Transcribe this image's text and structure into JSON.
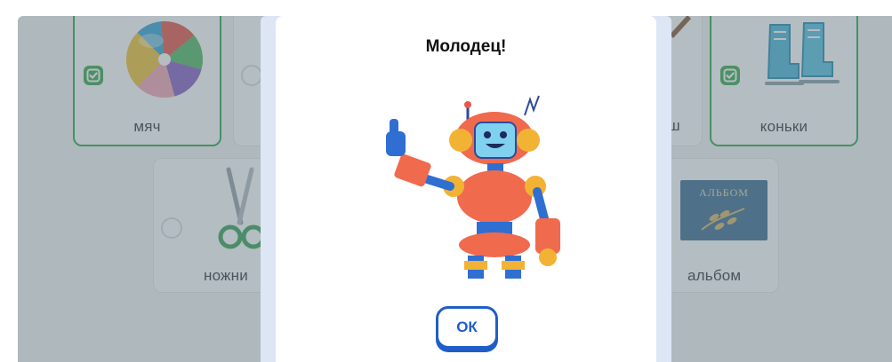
{
  "cards": {
    "ball_label": "мяч",
    "pencil_label_partial": "ш",
    "skates_label": "коньки",
    "scissors_label_partial": "ножни",
    "album_label": "альбом",
    "album_cover_text": "АЛЬБОМ"
  },
  "modal": {
    "title": "Молодец!",
    "ok_label": "ОК",
    "illustration": "robot-thumbs-up-icon"
  },
  "colors": {
    "selected_border": "#35a853",
    "check_fill": "#3cab52",
    "ok_accent": "#1f5ec8",
    "overlay": "rgba(96,114,124,0.47)"
  }
}
